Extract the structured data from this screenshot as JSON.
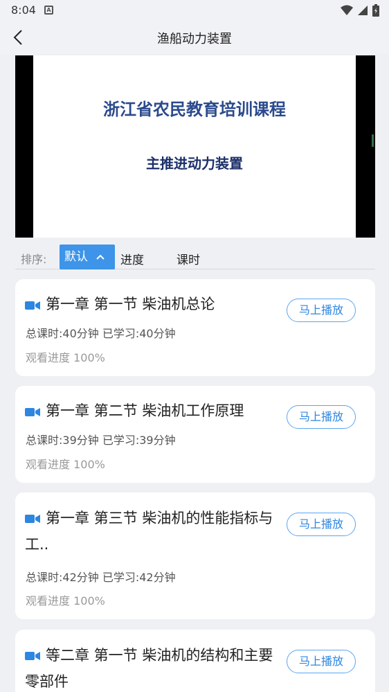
{
  "status_bar": {
    "time": "8:04",
    "notification_glyph": "A",
    "icons": [
      "wifi-icon",
      "signal-icon",
      "battery-icon"
    ]
  },
  "header": {
    "title": "渔船动力装置"
  },
  "video": {
    "slide_title": "浙江省农民教育培训课程",
    "slide_subtitle": "主推进动力装置"
  },
  "sort": {
    "label": "排序:",
    "options": [
      {
        "label": "默认"
      },
      {
        "label": "进度"
      },
      {
        "label": "课时"
      }
    ]
  },
  "lessons": [
    {
      "title": "第一章 第一节 柴油机总论",
      "total": "总课时:40分钟",
      "studied": "已学习:40分钟",
      "progress": "观看进度 100%",
      "play_label": "马上播放"
    },
    {
      "title": "第一章 第二节 柴油机工作原理",
      "total": "总课时:39分钟",
      "studied": "已学习:39分钟",
      "progress": "观看进度 100%",
      "play_label": "马上播放"
    },
    {
      "title": "第一章 第三节 柴油机的性能指标与工..",
      "total": "总课时:42分钟",
      "studied": "已学习:42分钟",
      "progress": "观看进度 100%",
      "play_label": "马上播放"
    },
    {
      "title": "等二章 第一节 柴油机的结构和主要零部件",
      "play_label": "马上播放"
    }
  ],
  "colors": {
    "accent": "#3d94e8",
    "background": "#eef0f4",
    "slide_title": "#2b4a8c"
  }
}
